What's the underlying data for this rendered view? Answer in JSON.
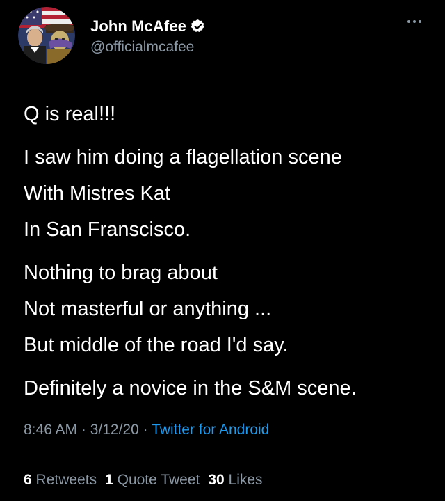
{
  "author": {
    "display_name": "John McAfee",
    "handle": "@officialmcafee",
    "verified": true
  },
  "icons": {
    "verified": "verified-badge-icon",
    "more": "more-options-icon"
  },
  "tweet": {
    "paragraphs": [
      [
        "Q is real!!!"
      ],
      [
        "I saw him doing a flagellation scene",
        "With Mistres Kat",
        "In San Franscisco."
      ],
      [
        "Nothing to brag about",
        "Not masterful or anything ...",
        "But middle of the road I'd say."
      ],
      [
        "Definitely a novice in the S&M scene."
      ]
    ]
  },
  "meta": {
    "time": "8:46 AM",
    "separator": " · ",
    "date": "3/12/20",
    "source": "Twitter for Android"
  },
  "stats": {
    "retweets_count": "6",
    "retweets_label": "Retweets",
    "quotes_count": "1",
    "quotes_label": "Quote Tweet",
    "likes_count": "30",
    "likes_label": "Likes"
  },
  "colors": {
    "background": "#000000",
    "text": "#ffffff",
    "secondary": "#8b98a5",
    "link": "#1d9bf0",
    "divider": "#2f3336"
  }
}
